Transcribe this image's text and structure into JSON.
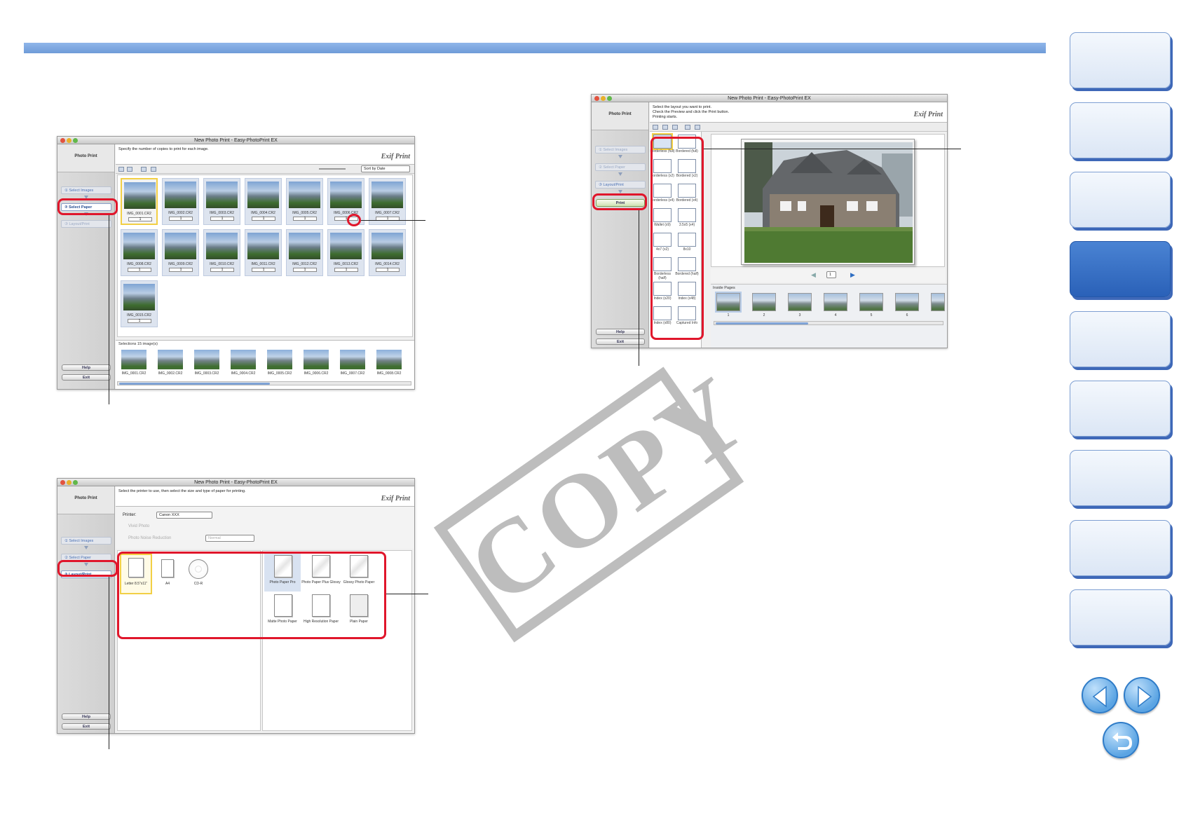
{
  "decorations": {
    "watermark_text": "COPY"
  },
  "side_nav": {
    "tabs": [
      "",
      "",
      "",
      "",
      "",
      "",
      "",
      "",
      ""
    ],
    "active_index": 3
  },
  "page_nav": {
    "prev": "previous-page",
    "next": "next-page",
    "back": "return"
  },
  "window_select_images": {
    "title": "New Photo Print - Easy-PhotoPrint EX",
    "app_label": "Photo Print",
    "instruction": "Specify the number of copies to print for each image.",
    "logo": "Exif Print",
    "steps": [
      "① Select Images",
      "② Select Paper",
      "③ Layout/Print"
    ],
    "help": "Help",
    "exit": "Exit",
    "sort_label": "Sort by Date",
    "thumbnails": [
      {
        "name": "IMG_0001.CR2",
        "copies": "1"
      },
      {
        "name": "IMG_0002.CR2",
        "copies": "1"
      },
      {
        "name": "IMG_0003.CR2",
        "copies": "1"
      },
      {
        "name": "IMG_0004.CR2",
        "copies": "1"
      },
      {
        "name": "IMG_0005.CR2",
        "copies": "1"
      },
      {
        "name": "IMG_0006.CR2",
        "copies": "1"
      },
      {
        "name": "IMG_0007.CR2",
        "copies": "1"
      },
      {
        "name": "IMG_0008.CR2",
        "copies": "1"
      },
      {
        "name": "IMG_0009.CR2",
        "copies": "1"
      },
      {
        "name": "IMG_0010.CR2",
        "copies": "1"
      },
      {
        "name": "IMG_0011.CR2",
        "copies": "1"
      },
      {
        "name": "IMG_0012.CR2",
        "copies": "1"
      },
      {
        "name": "IMG_0013.CR2",
        "copies": "1"
      },
      {
        "name": "IMG_0014.CR2",
        "copies": "1"
      },
      {
        "name": "IMG_0015.CR2",
        "copies": "1"
      }
    ],
    "selections_label": "Selections 15 image(s)",
    "strip": [
      "IMG_0001.CR2",
      "IMG_0002.CR2",
      "IMG_0003.CR2",
      "IMG_0004.CR2",
      "IMG_0005.CR2",
      "IMG_0006.CR2",
      "IMG_0007.CR2",
      "IMG_0008.CR2"
    ]
  },
  "window_select_paper": {
    "title": "New Photo Print - Easy-PhotoPrint EX",
    "app_label": "Photo Print",
    "instruction": "Select the printer to use, then select the size and type of paper for printing.",
    "logo": "Exif Print",
    "steps": [
      "① Select Images",
      "② Select Paper",
      "③ Layout/Print"
    ],
    "help": "Help",
    "exit": "Exit",
    "printer_label": "Printer:",
    "printer_value": "Canon XXX",
    "vivid_photo": "Vivid Photo",
    "noise_reduction": "Photo Noise Reduction",
    "noise_level": "Normal",
    "paper_sizes": [
      {
        "label": "Letter 8.5\"x11\""
      },
      {
        "label": "A4"
      },
      {
        "label": "CD-R"
      }
    ],
    "paper_types": [
      {
        "label": "Photo Paper Pro"
      },
      {
        "label": "Photo Paper Plus Glossy"
      },
      {
        "label": "Glossy Photo Paper"
      },
      {
        "label": "Matte Photo Paper"
      },
      {
        "label": "High Resolution Paper"
      },
      {
        "label": "Plain Paper"
      }
    ]
  },
  "window_layout_print": {
    "title": "New Photo Print - Easy-PhotoPrint EX",
    "app_label": "Photo Print",
    "instruction_1": "Select the layout you want to print.",
    "instruction_2": "Check the Preview and click the Print button.",
    "instruction_3": "Printing starts.",
    "logo": "Exif Print",
    "steps": [
      "① Select Images",
      "② Select Paper",
      "③ Layout/Print"
    ],
    "print": "Print",
    "help": "Help",
    "exit": "Exit",
    "layouts": [
      {
        "label": "Borderless (full)"
      },
      {
        "label": "Bordered (full)"
      },
      {
        "label": "Borderless (x2)"
      },
      {
        "label": "Bordered (x2)"
      },
      {
        "label": "Borderless (x4)"
      },
      {
        "label": "Bordered (x4)"
      },
      {
        "label": "Wallet (x9)"
      },
      {
        "label": "3.5x5 (x4)"
      },
      {
        "label": "4x7 (x2)"
      },
      {
        "label": "8x10"
      },
      {
        "label": "Borderless (half)"
      },
      {
        "label": "Bordered (half)"
      },
      {
        "label": "Index (x20)"
      },
      {
        "label": "Index (x48)"
      },
      {
        "label": "Index (x80)"
      },
      {
        "label": "Captured Info"
      }
    ],
    "page_indicator": "1",
    "inside_pages_label": "Inside Pages",
    "pages": [
      "1",
      "2",
      "3",
      "4",
      "5",
      "6"
    ]
  }
}
